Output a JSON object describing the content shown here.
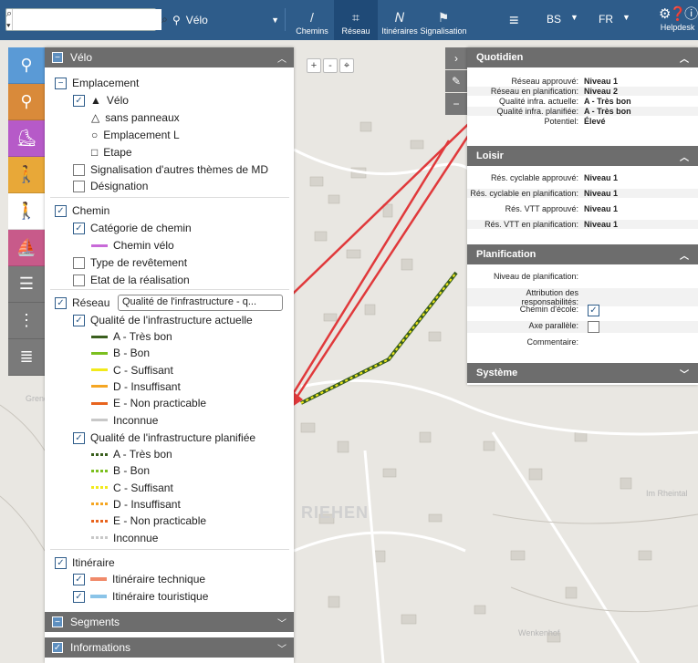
{
  "topbar": {
    "search_placeholder": "",
    "theme": "Vélo",
    "nav": [
      {
        "label": "Chemins"
      },
      {
        "label": "Réseau"
      },
      {
        "label": "Itinéraires"
      },
      {
        "label": "Signalisation"
      }
    ],
    "canton": "BS",
    "language": "FR",
    "help_label": "Helpdesk"
  },
  "map": {
    "place_label": "RIEHEN",
    "small_labels": [
      "Wenkenhof",
      "Im Rheintal",
      "Grend"
    ]
  },
  "panel": {
    "title": "Vélo",
    "emplacement": "Emplacement",
    "emplacement_items": [
      "Vélo",
      "sans panneaux",
      "Emplacement L",
      "Etape"
    ],
    "signalisation": "Signalisation d'autres thèmes de MD",
    "designation": "Désignation",
    "chemin": "Chemin",
    "categorie": "Catégorie de chemin",
    "chemin_velo": "Chemin vélo",
    "type_revetement": "Type de revêtement",
    "etat_realisation": "Etat de la réalisation",
    "reseau": "Réseau",
    "reseau_select": "Qualité de l'infrastructure - q...",
    "qualite_actuelle": "Qualité de l'infrastructure actuelle",
    "qualite_planifiee": "Qualité de l'infrastructure planifiée",
    "qualite_items": [
      "A - Très bon",
      "B - Bon",
      "C - Suffisant",
      "D - Insuffisant",
      "E - Non practicable",
      "Inconnue"
    ],
    "qualite_colors": [
      "#3a5f1e",
      "#7bbf1f",
      "#f2ea1a",
      "#f5a623",
      "#e8641e",
      "#c8c8c8"
    ],
    "itineraire": "Itinéraire",
    "itin_technique": "Itinéraire technique",
    "itin_touristique": "Itinéraire touristique",
    "segments": "Segments",
    "informations": "Informations"
  },
  "info": {
    "quotidien": "Quotidien",
    "quotidien_rows": [
      {
        "k": "Réseau approuvé:",
        "v": "Niveau 1"
      },
      {
        "k": "Réseau en planification:",
        "v": "Niveau 2"
      },
      {
        "k": "Qualité infra. actuelle:",
        "v": "A - Très bon"
      },
      {
        "k": "Qualité infra. planifiée:",
        "v": "A - Très bon"
      },
      {
        "k": "Potentiel:",
        "v": "Élevé"
      }
    ],
    "loisir": "Loisir",
    "loisir_rows": [
      {
        "k": "Rés. cyclable approuvé:",
        "v": "Niveau 1"
      },
      {
        "k": "Rés. cyclable en planification:",
        "v": "Niveau 1"
      },
      {
        "k": "Rés. VTT approuvé:",
        "v": "Niveau 1"
      },
      {
        "k": "Rés. VTT en planification:",
        "v": "Niveau 1"
      }
    ],
    "planification": "Planification",
    "planif_rows": [
      {
        "k": "Niveau de planification:",
        "v": ""
      },
      {
        "k": "Attribution des responsabilités:",
        "v": ""
      },
      {
        "k": "Chemin d'école:",
        "v": ""
      },
      {
        "k": "Axe parallèle:",
        "v": ""
      },
      {
        "k": "Commentaire:",
        "v": ""
      }
    ],
    "systeme": "Système"
  }
}
